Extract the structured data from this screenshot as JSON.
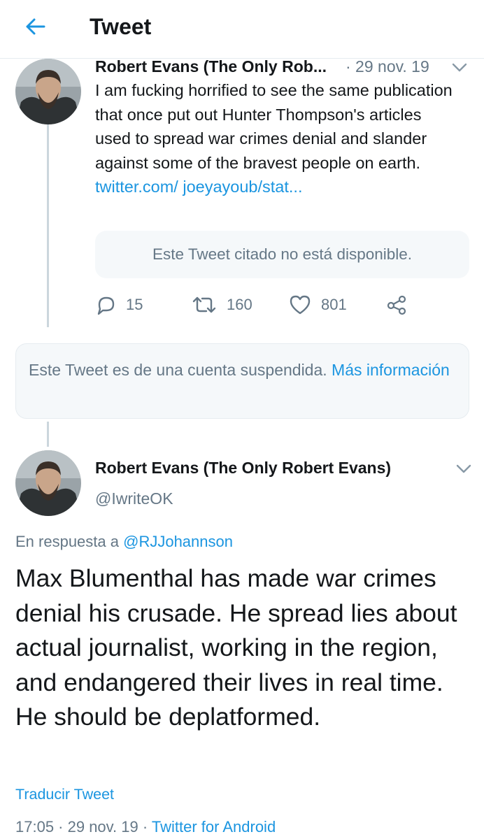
{
  "header": {
    "title": "Tweet",
    "back_icon": "arrow-left-icon",
    "accent_color": "#1b95e0"
  },
  "tweet1": {
    "author_name": "Robert Evans (The Only Rob...",
    "date": "· 29 nov. 19",
    "body": "I am fucking horrified to see the same publication that once put out Hunter Thompson's articles used to spread war crimes denial and slander against some of the bravest people on earth. ",
    "link": "twitter.com/ joeyayoub/stat...",
    "quoted_unavailable": "Este Tweet citado no está disponible.",
    "replies": "15",
    "retweets": "160",
    "likes": "801",
    "icons": [
      "reply-icon",
      "retweet-icon",
      "like-icon",
      "share-icon",
      "chevron-down-icon"
    ]
  },
  "suspended": {
    "text": "Este Tweet es de una cuenta suspendida. ",
    "link": "Más información"
  },
  "tweet2": {
    "author_name": "Robert Evans (The Only Robert Evans)",
    "handle": "@IwriteOK",
    "reply_prefix": "En respuesta a ",
    "reply_handle": "@RJJohannson",
    "body": "Max Blumenthal has made war crimes denial his crusade. He spread lies about actual journalist, working in the region, and endangered their lives in real time. He should be deplatformed.",
    "translate": "Traducir Tweet",
    "time": "17:05 · 29 nov. 19 · ",
    "source": "Twitter for Android"
  }
}
